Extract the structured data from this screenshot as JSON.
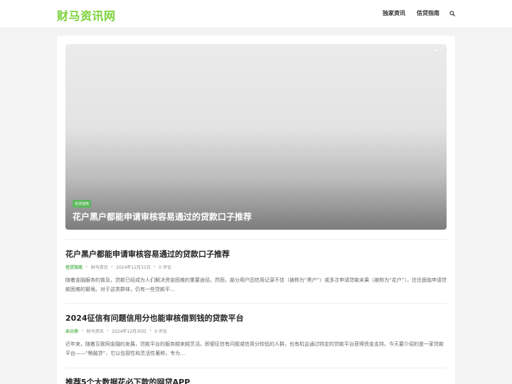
{
  "site": {
    "logo": "财马资讯网"
  },
  "nav": {
    "items": [
      "独家资讯",
      "信贷指南"
    ]
  },
  "slider": {
    "tag": "信贷指南",
    "title": "花户黑户都能申请审核容易通过的贷款口子推荐"
  },
  "posts": [
    {
      "title": "花户黑户都能申请审核容易通过的贷款口子推荐",
      "category": "信贷指南",
      "author": "财马资讯",
      "date": "2024年12月31日",
      "comments": "0 评论",
      "excerpt": "随着金融服务的普及，贷款已经成为人们解决资金困难的重要途径。然而，部分用户因信用记录不佳（被称为“黑户”）或多次申请贷款未果（被称为“花户”），往往面临申请贷款困难的窘境。对于这类群体，仍有一些贷款平…"
    },
    {
      "title": "2024征信有问题信用分也能审核借到钱的贷款平台",
      "category": "未分类",
      "author": "财马资讯",
      "date": "2024年12月30日",
      "comments": "0 评论",
      "excerpt": "近年来，随着互联网金融的发展，贷款平台的服务越来越灵活。即便征信有问题或信用分较低的人群，也有机会通过特定的贷款平台获得资金支持。今天要介绍的是一家贷款平台——“畅融贷”，它以包容性和灵活性著称，专为…"
    },
    {
      "title": "推荐5个大数据花必下款的网贷APP"
    }
  ]
}
